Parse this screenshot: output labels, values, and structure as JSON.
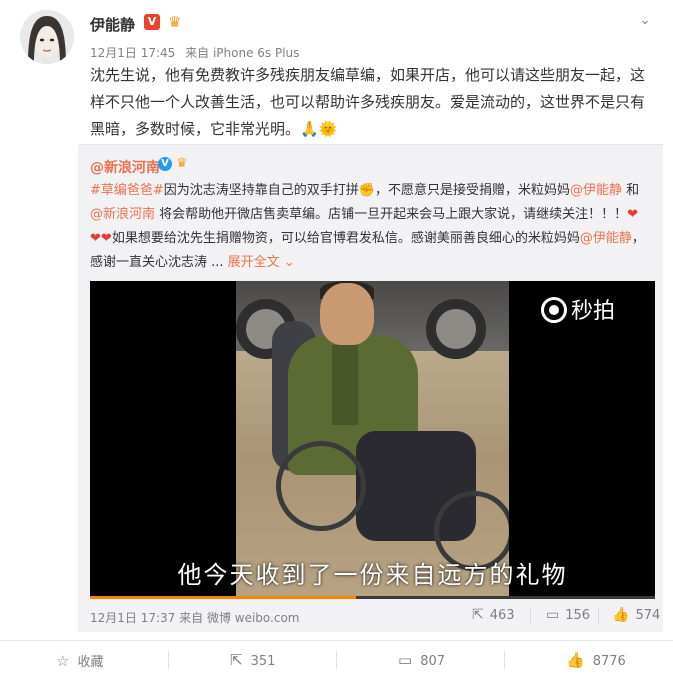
{
  "author": {
    "name": "伊能静",
    "verified_badge": "V",
    "date": "12月1日 17:45",
    "source": "来自 iPhone 6s Plus"
  },
  "post": {
    "text": "沈先生说，他有免费教许多残疾朋友编草编，如果开店，他可以请这些朋友一起，这样不只他一个人改善生活，也可以帮助许多残疾朋友。爱是流动的，这世界不是只有黑暗，多数时候，它非常光明。",
    "emoji": "🙏🌞"
  },
  "repost": {
    "author": "@新浪河南",
    "topic": "#草编爸爸#",
    "text_1": "因为沈志涛坚持靠自己的双手打拼",
    "fist_emoji": "✊",
    "text_2": "，不愿意只是接受捐赠，米粒妈妈",
    "mention_1": "@伊能静",
    "text_3": " 和",
    "mention_2": "@新浪河南",
    "text_4": " 将会帮助他开微店售卖草编。店铺一旦开起来会马上跟大家说，请继续关注！！！",
    "hearts": "❤",
    "text_5": "如果想要给沈先生捐赠物资，可以给官博君发私信。感谢美丽善良细心的米粒妈妈",
    "mention_3": "@伊能静",
    "text_6": "，感谢一直关心沈志涛 ...",
    "expand_label": "展开全文",
    "expand_icon": "chevron-down-icon",
    "video": {
      "subtitle": "他今天收到了一份来自远方的礼物",
      "watermark": "秒拍",
      "progress": 0.47
    },
    "footer": {
      "date": "12月1日 17:37",
      "source": "来自 微博 weibo.com",
      "reposts": "463",
      "comments": "156",
      "likes": "574"
    }
  },
  "actions": {
    "favorite_label": "收藏",
    "repost_count": "351",
    "comment_count": "807",
    "like_count": "8776"
  },
  "colors": {
    "link": "#eb7350",
    "accent_orange": "#ff8200",
    "verified_red": "#e8412c",
    "verified_blue": "#1f9ef0"
  }
}
